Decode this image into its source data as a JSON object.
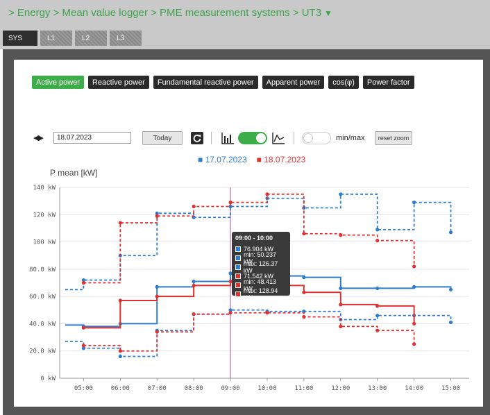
{
  "breadcrumb": {
    "text": "> Energy > Mean value logger > PME measurement systems > UT3",
    "dropdown_icon": "▼"
  },
  "tabs": [
    {
      "label": "SYS",
      "active": true
    },
    {
      "label": "L1",
      "active": false
    },
    {
      "label": "L2",
      "active": false
    },
    {
      "label": "L3",
      "active": false
    }
  ],
  "measure_buttons": [
    {
      "label": "Active power",
      "active": true
    },
    {
      "label": "Reactive power",
      "active": false
    },
    {
      "label": "Fundamental reactive power",
      "active": false
    },
    {
      "label": "Apparent power",
      "active": false
    },
    {
      "label": "cos(φ)",
      "active": false
    },
    {
      "label": "Power factor",
      "active": false
    }
  ],
  "controls": {
    "arrows": "◀▶",
    "date_value": "18.07.2023",
    "today_label": "Today",
    "minmax_label": "min/max",
    "reset_zoom_label": "reset zoom",
    "chart_type_toggle_on": true,
    "minmax_toggle_on": false
  },
  "legend": {
    "s1": "■ 17.07.2023",
    "s2": "■ 18.07.2023"
  },
  "colors": {
    "s1": "#2e7ccd",
    "s2": "#e03131",
    "accent": "#3cad48",
    "cursor": "#c0509a"
  },
  "tooltip": {
    "title": "09:00 - 10:00",
    "rows": [
      {
        "text": "76.904 kW",
        "series": "s1"
      },
      {
        "text": "min: 50.237 kW",
        "series": "s1"
      },
      {
        "text": "max: 126.37 kW",
        "series": "s1"
      },
      {
        "text": "71.542 kW",
        "series": "s2"
      },
      {
        "text": "min: 48.413 kW",
        "series": "s2"
      },
      {
        "text": "max: 128.94 kW",
        "series": "s2"
      }
    ]
  },
  "chart_data": {
    "type": "line",
    "step": true,
    "ylabel": "P mean [kW]",
    "ylim": [
      0,
      140
    ],
    "y_ticks": [
      "0 kW",
      "20.0 kW",
      "40.0 kW",
      "60.0 kW",
      "80.0 kW",
      "100 kW",
      "120 kW",
      "140 kW"
    ],
    "x_ticks": [
      "05:00",
      "06:00",
      "07:00",
      "08:00",
      "09:00",
      "10:00",
      "11:00",
      "12:00",
      "13:00",
      "14:00",
      "15:00"
    ],
    "cursor": "09:00",
    "series": [
      {
        "name": "17.07.2023",
        "hours": [
          4.5,
          5,
          6,
          7,
          8,
          9,
          10,
          11,
          12,
          13,
          14
        ],
        "end": 15,
        "mean": [
          39,
          38,
          40,
          67,
          71,
          77,
          75,
          74,
          66,
          66,
          67
        ],
        "min": [
          27,
          22,
          16,
          35,
          47,
          50,
          49,
          49,
          43,
          46,
          46
        ],
        "max": [
          65,
          72,
          90,
          121,
          118,
          126,
          132,
          125,
          135,
          109,
          129
        ],
        "end_points": {
          "mean": 65,
          "min": 41,
          "max": 107
        }
      },
      {
        "name": "18.07.2023",
        "hours": [
          5,
          6,
          7,
          8,
          9,
          10,
          11,
          12,
          13
        ],
        "end": 14,
        "mean": [
          37,
          57,
          60,
          68,
          71,
          68,
          63,
          54,
          53
        ],
        "min": [
          24,
          20,
          34,
          47,
          48,
          48,
          45,
          38,
          35
        ],
        "max": [
          70,
          114,
          119,
          126,
          129,
          135,
          106,
          105,
          101
        ],
        "end_points": {
          "mean": 40,
          "min": 25,
          "max": 82
        }
      }
    ]
  }
}
